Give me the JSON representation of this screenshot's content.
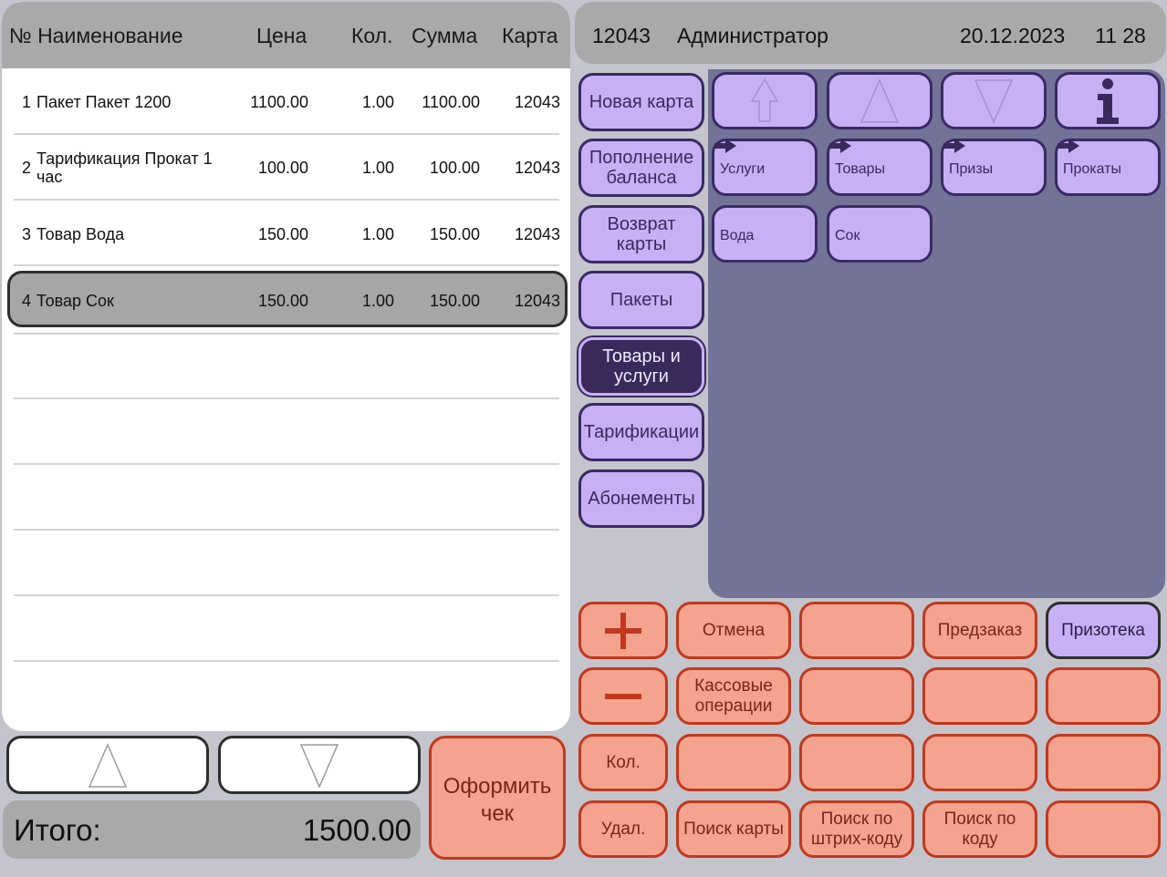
{
  "table": {
    "headers": {
      "name": "№ Наименование",
      "price": "Цена",
      "qty": "Кол.",
      "sum": "Сумма",
      "card": "Карта"
    },
    "rows": [
      {
        "num": "1",
        "name": "Пакет Пакет 1200",
        "price": "1100.00",
        "qty": "1.00",
        "sum": "1100.00",
        "card": "12043"
      },
      {
        "num": "2",
        "name": "Тарификация Прокат 1 час",
        "price": "100.00",
        "qty": "1.00",
        "sum": "100.00",
        "card": "12043"
      },
      {
        "num": "3",
        "name": "Товар Вода",
        "price": "150.00",
        "qty": "1.00",
        "sum": "150.00",
        "card": "12043"
      },
      {
        "num": "4",
        "name": "Товар Сок",
        "price": "150.00",
        "qty": "1.00",
        "sum": "150.00",
        "card": "12043"
      }
    ],
    "selected_row": 4
  },
  "total": {
    "label": "Итого:",
    "value": "1500.00"
  },
  "checkout": {
    "label": "Оформить чек"
  },
  "header": {
    "card_id": "12043",
    "user": "Администратор",
    "date": "20.12.2023",
    "time": "11 28"
  },
  "categories": [
    {
      "label": "Новая карта"
    },
    {
      "label": "Пополнение баланса"
    },
    {
      "label": "Возврат карты"
    },
    {
      "label": "Пакеты"
    },
    {
      "label": "Товары и услуги",
      "active": true
    },
    {
      "label": "Тарификации"
    },
    {
      "label": "Абонементы"
    }
  ],
  "item_nav": {
    "icons": [
      "back-up-icon",
      "up-arrow-icon",
      "down-arrow-icon",
      "info-icon"
    ]
  },
  "items": {
    "folders": [
      "Услуги",
      "Товары",
      "Призы",
      "Прокаты"
    ],
    "products": [
      "Вода",
      "Сок"
    ]
  },
  "functions": {
    "plus": "+",
    "minus": "−",
    "cancel": "Отмена",
    "preorder": "Предзаказ",
    "prize_shop": "Призотека",
    "cash_ops": "Кассовые операции",
    "qty": "Кол.",
    "delete": "Удал.",
    "find_card": "Поиск карты",
    "find_barcode": "Поиск по штрих-коду",
    "find_code": "Поиск по коду"
  },
  "colors": {
    "orange": "#f4a38f",
    "purple": "#c8b0f5",
    "items_bg": "#727397",
    "active": "#3a2a5c"
  }
}
